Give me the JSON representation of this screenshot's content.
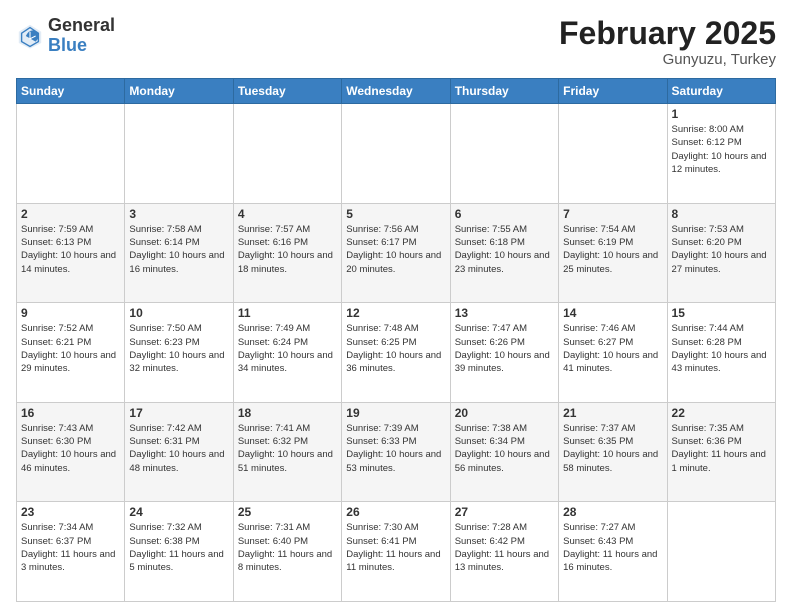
{
  "header": {
    "logo_general": "General",
    "logo_blue": "Blue",
    "title": "February 2025",
    "subtitle": "Gunyuzu, Turkey"
  },
  "days_of_week": [
    "Sunday",
    "Monday",
    "Tuesday",
    "Wednesday",
    "Thursday",
    "Friday",
    "Saturday"
  ],
  "weeks": [
    [
      {
        "day": "",
        "info": ""
      },
      {
        "day": "",
        "info": ""
      },
      {
        "day": "",
        "info": ""
      },
      {
        "day": "",
        "info": ""
      },
      {
        "day": "",
        "info": ""
      },
      {
        "day": "",
        "info": ""
      },
      {
        "day": "1",
        "info": "Sunrise: 8:00 AM\nSunset: 6:12 PM\nDaylight: 10 hours\nand 12 minutes."
      }
    ],
    [
      {
        "day": "2",
        "info": "Sunrise: 7:59 AM\nSunset: 6:13 PM\nDaylight: 10 hours\nand 14 minutes."
      },
      {
        "day": "3",
        "info": "Sunrise: 7:58 AM\nSunset: 6:14 PM\nDaylight: 10 hours\nand 16 minutes."
      },
      {
        "day": "4",
        "info": "Sunrise: 7:57 AM\nSunset: 6:16 PM\nDaylight: 10 hours\nand 18 minutes."
      },
      {
        "day": "5",
        "info": "Sunrise: 7:56 AM\nSunset: 6:17 PM\nDaylight: 10 hours\nand 20 minutes."
      },
      {
        "day": "6",
        "info": "Sunrise: 7:55 AM\nSunset: 6:18 PM\nDaylight: 10 hours\nand 23 minutes."
      },
      {
        "day": "7",
        "info": "Sunrise: 7:54 AM\nSunset: 6:19 PM\nDaylight: 10 hours\nand 25 minutes."
      },
      {
        "day": "8",
        "info": "Sunrise: 7:53 AM\nSunset: 6:20 PM\nDaylight: 10 hours\nand 27 minutes."
      }
    ],
    [
      {
        "day": "9",
        "info": "Sunrise: 7:52 AM\nSunset: 6:21 PM\nDaylight: 10 hours\nand 29 minutes."
      },
      {
        "day": "10",
        "info": "Sunrise: 7:50 AM\nSunset: 6:23 PM\nDaylight: 10 hours\nand 32 minutes."
      },
      {
        "day": "11",
        "info": "Sunrise: 7:49 AM\nSunset: 6:24 PM\nDaylight: 10 hours\nand 34 minutes."
      },
      {
        "day": "12",
        "info": "Sunrise: 7:48 AM\nSunset: 6:25 PM\nDaylight: 10 hours\nand 36 minutes."
      },
      {
        "day": "13",
        "info": "Sunrise: 7:47 AM\nSunset: 6:26 PM\nDaylight: 10 hours\nand 39 minutes."
      },
      {
        "day": "14",
        "info": "Sunrise: 7:46 AM\nSunset: 6:27 PM\nDaylight: 10 hours\nand 41 minutes."
      },
      {
        "day": "15",
        "info": "Sunrise: 7:44 AM\nSunset: 6:28 PM\nDaylight: 10 hours\nand 43 minutes."
      }
    ],
    [
      {
        "day": "16",
        "info": "Sunrise: 7:43 AM\nSunset: 6:30 PM\nDaylight: 10 hours\nand 46 minutes."
      },
      {
        "day": "17",
        "info": "Sunrise: 7:42 AM\nSunset: 6:31 PM\nDaylight: 10 hours\nand 48 minutes."
      },
      {
        "day": "18",
        "info": "Sunrise: 7:41 AM\nSunset: 6:32 PM\nDaylight: 10 hours\nand 51 minutes."
      },
      {
        "day": "19",
        "info": "Sunrise: 7:39 AM\nSunset: 6:33 PM\nDaylight: 10 hours\nand 53 minutes."
      },
      {
        "day": "20",
        "info": "Sunrise: 7:38 AM\nSunset: 6:34 PM\nDaylight: 10 hours\nand 56 minutes."
      },
      {
        "day": "21",
        "info": "Sunrise: 7:37 AM\nSunset: 6:35 PM\nDaylight: 10 hours\nand 58 minutes."
      },
      {
        "day": "22",
        "info": "Sunrise: 7:35 AM\nSunset: 6:36 PM\nDaylight: 11 hours\nand 1 minute."
      }
    ],
    [
      {
        "day": "23",
        "info": "Sunrise: 7:34 AM\nSunset: 6:37 PM\nDaylight: 11 hours\nand 3 minutes."
      },
      {
        "day": "24",
        "info": "Sunrise: 7:32 AM\nSunset: 6:38 PM\nDaylight: 11 hours\nand 5 minutes."
      },
      {
        "day": "25",
        "info": "Sunrise: 7:31 AM\nSunset: 6:40 PM\nDaylight: 11 hours\nand 8 minutes."
      },
      {
        "day": "26",
        "info": "Sunrise: 7:30 AM\nSunset: 6:41 PM\nDaylight: 11 hours\nand 11 minutes."
      },
      {
        "day": "27",
        "info": "Sunrise: 7:28 AM\nSunset: 6:42 PM\nDaylight: 11 hours\nand 13 minutes."
      },
      {
        "day": "28",
        "info": "Sunrise: 7:27 AM\nSunset: 6:43 PM\nDaylight: 11 hours\nand 16 minutes."
      },
      {
        "day": "",
        "info": ""
      }
    ]
  ]
}
